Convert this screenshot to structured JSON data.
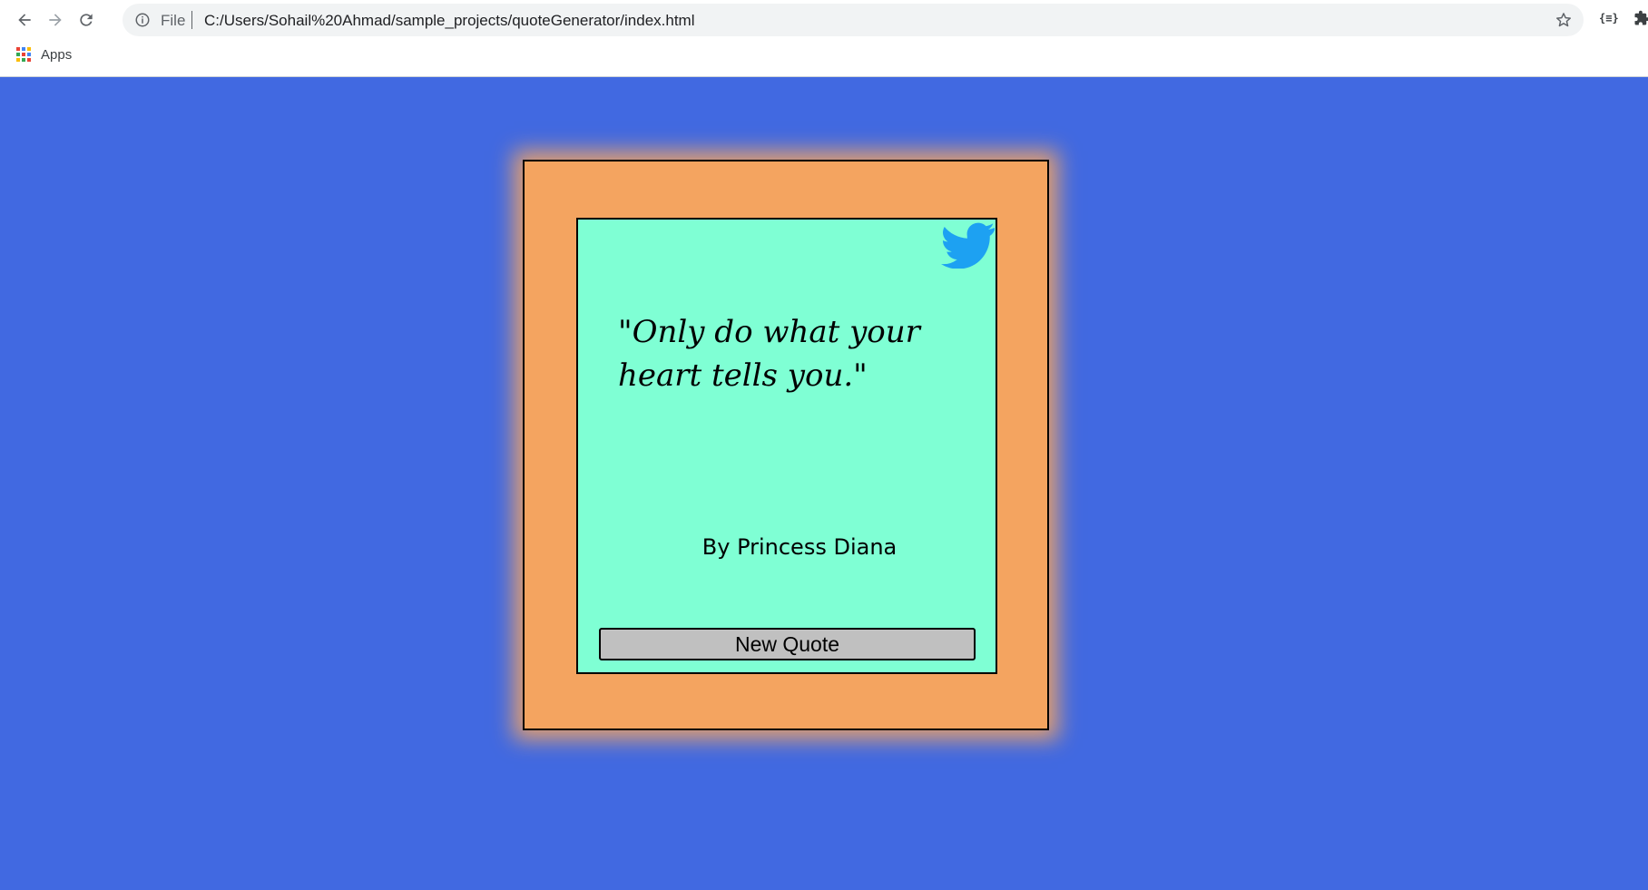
{
  "browser": {
    "scheme_label": "File",
    "url": "C:/Users/Sohail%20Ahmad/sample_projects/quoteGenerator/index.html",
    "extension_label": "{≡}",
    "bookmarks": {
      "apps_label": "Apps"
    }
  },
  "quote_card": {
    "quote": "\"Only do what your heart tells you.\"",
    "author": "By Princess Diana",
    "new_quote_label": "New Quote",
    "share_icon": "twitter-icon"
  },
  "colors": {
    "page_background": "#4169e1",
    "outer_card": "#f4a460",
    "inner_card": "#7fffd4",
    "button": "#c0c0c0",
    "twitter_blue": "#1da1f2"
  }
}
